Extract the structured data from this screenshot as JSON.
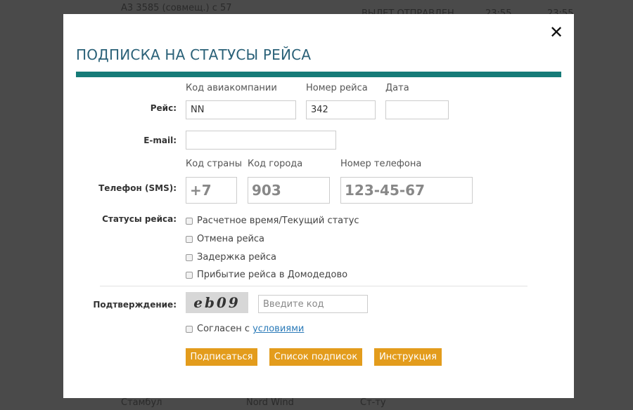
{
  "background": {
    "top_text": "А3 3585 (совмещ.) с 57",
    "top_right_1": "ВЫЛЕТ ОТПРАВЛЕН",
    "top_right_2": "23:55",
    "top_right_3": "23:55",
    "bottom_1": "Стамбул",
    "bottom_2": "Nord Wind",
    "bottom_3": "Ст-ту"
  },
  "modal": {
    "title": "ПОДПИСКА НА СТАТУСЫ РЕЙСА",
    "close_symbol": "✕",
    "accent_color": "#167b78"
  },
  "flight": {
    "label": "Рейс:",
    "airline_code_label": "Код авиакомпании",
    "airline_code_value": "NN",
    "flight_number_label": "Номер рейса",
    "flight_number_value": "342",
    "date_label": "Дата",
    "date_value": ""
  },
  "email": {
    "label": "E-mail:",
    "value": ""
  },
  "phone": {
    "label": "Телефон (SMS):",
    "country_code_label": "Код страны",
    "country_code_placeholder": "+7",
    "city_code_label": "Код города",
    "city_code_placeholder": "903",
    "number_label": "Номер телефона",
    "number_placeholder": "123-45-67"
  },
  "statuses": {
    "label": "Статусы рейса:",
    "options": [
      "Расчетное время/Текущий статус",
      "Отмена рейса",
      "Задержка рейса",
      "Прибытие рейса в Домодедово"
    ]
  },
  "confirmation": {
    "label": "Подтверждение:",
    "captcha_text": "eb09",
    "code_placeholder": "Введите код",
    "agree_text": "Согласен с",
    "agree_link": "условиями"
  },
  "buttons": {
    "subscribe": "Подписаться",
    "list": "Список подписок",
    "instructions": "Инструкция",
    "color": "#e39c1c"
  }
}
